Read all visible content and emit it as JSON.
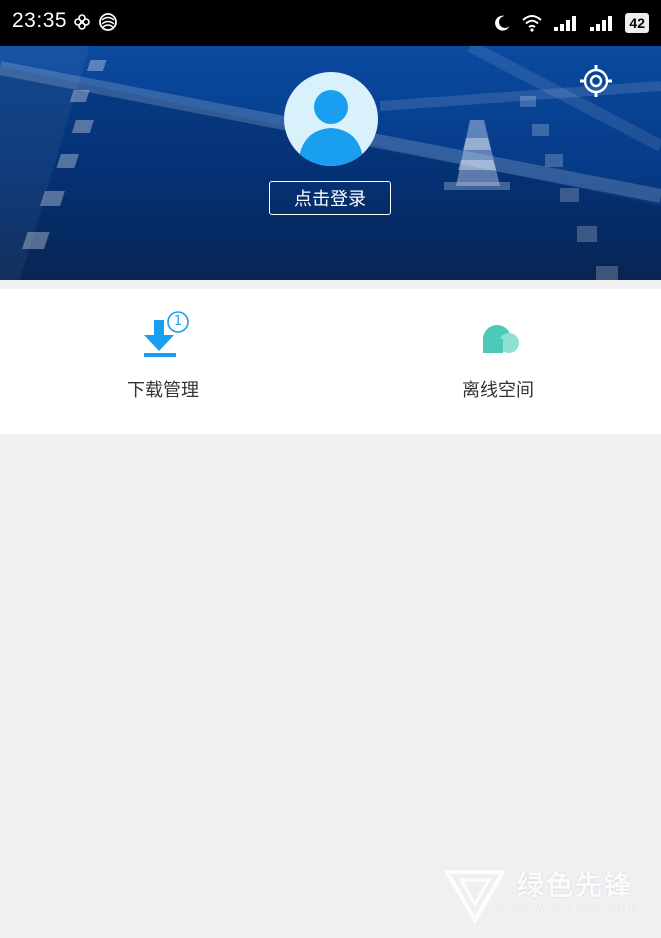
{
  "status_bar": {
    "time": "23:35",
    "battery": "42"
  },
  "header": {
    "login_label": "点击登录"
  },
  "menu": {
    "items": [
      {
        "label": "下载管理",
        "icon": "download-icon",
        "badge": "1"
      },
      {
        "label": "离线空间",
        "icon": "cloud-icon"
      }
    ]
  },
  "watermark": {
    "name": "绿色先锋",
    "url": "www.greenxf.com"
  },
  "colors": {
    "header_blue": "#063a86",
    "accent_blue": "#1a9ef0",
    "cloud_teal": "#4dc9b8",
    "background": "#eff0f2"
  }
}
